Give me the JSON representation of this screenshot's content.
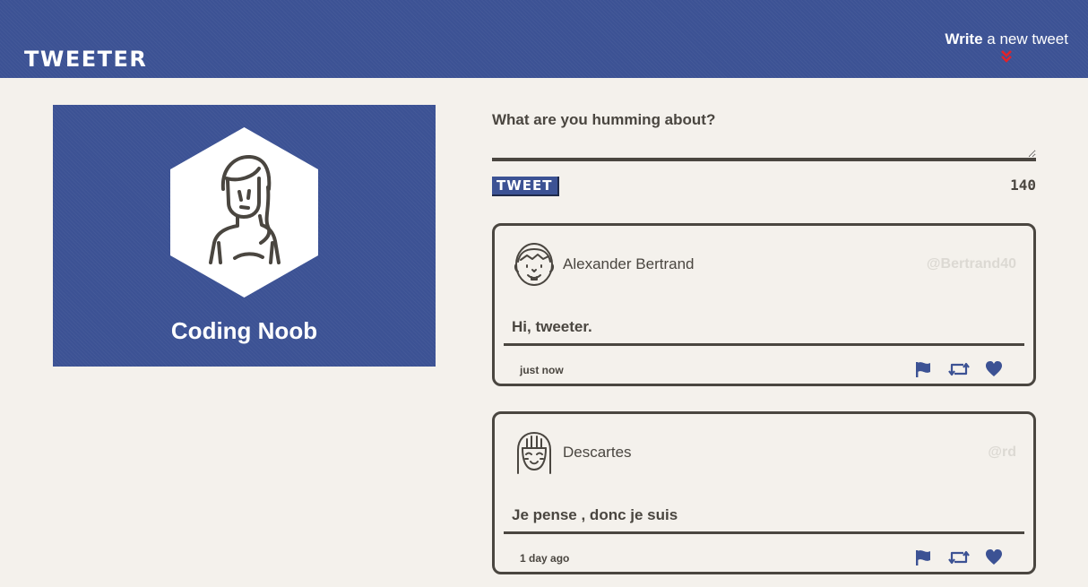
{
  "nav": {
    "brand": "TWEETER",
    "compose_link": {
      "strong": "Write",
      "rest": " a new tweet",
      "arrow_icon": "double-chevron-down-icon"
    }
  },
  "profile": {
    "name": "Coding Noob",
    "avatar_icon": "woman-avatar-icon"
  },
  "compose": {
    "placeholder": "What are you humming about?",
    "value": "",
    "button_label": "TWEET",
    "counter": "140"
  },
  "tweets": [
    {
      "name": "Alexander Bertrand",
      "handle": "@Bertrand40",
      "text": "Hi, tweeter.",
      "time": "just now",
      "avatar_icon": "boy-avatar-icon"
    },
    {
      "name": "Descartes",
      "handle": "@rd",
      "text": "Je pense , donc je suis",
      "time": "1 day ago",
      "avatar_icon": "girl-avatar-icon"
    }
  ],
  "actions": {
    "flag_icon": "flag-icon",
    "retweet_icon": "retweet-icon",
    "like_icon": "heart-icon"
  },
  "colors": {
    "primary": "#3c5294",
    "background": "#f4f1ec",
    "text": "#4a4640",
    "handle": "#dcd9d3",
    "arrow": "#e2222a"
  }
}
